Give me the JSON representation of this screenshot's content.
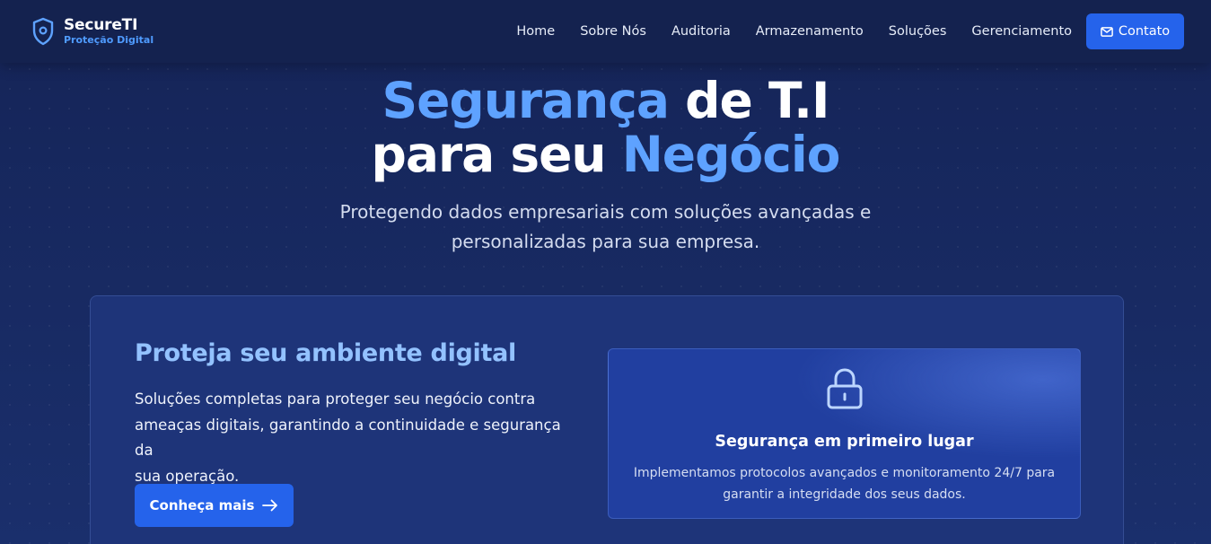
{
  "brand": {
    "name": "SecureTI",
    "tagline": "Proteção Digital",
    "icon": "shield-icon"
  },
  "nav": {
    "items": [
      "Home",
      "Sobre Nós",
      "Auditoria",
      "Armazenamento",
      "Soluções",
      "Gerenciamento"
    ],
    "contact_label": "Contato",
    "contact_icon": "mail-icon"
  },
  "hero": {
    "title_accent_1": "Segurança",
    "title_plain_1": " de T.I",
    "title_plain_2": "para seu ",
    "title_accent_2": "Negócio",
    "subtitle_line1": "Protegendo dados empresariais com soluções avançadas e",
    "subtitle_line2": "personalizadas para sua empresa."
  },
  "card": {
    "title": "Proteja seu ambiente digital",
    "text_line1": "Soluções completas para proteger seu negócio contra",
    "text_line2": "ameaças digitais, garantindo a continuidade e segurança da",
    "text_line3": "sua operação.",
    "button_label": "Conheça mais",
    "button_icon": "arrow-right-icon"
  },
  "feature": {
    "icon": "lock-icon",
    "title": "Segurança em primeiro lugar",
    "text_line1": "Implementamos protocolos avançados e monitoramento 24/7 para",
    "text_line2": "garantir a integridade dos seus dados."
  },
  "colors": {
    "background": "#172a63",
    "nav": "#14224f",
    "accent": "#5ea2ff",
    "button": "#2563eb",
    "card": "#1e3479",
    "feature": "#213fa0"
  }
}
